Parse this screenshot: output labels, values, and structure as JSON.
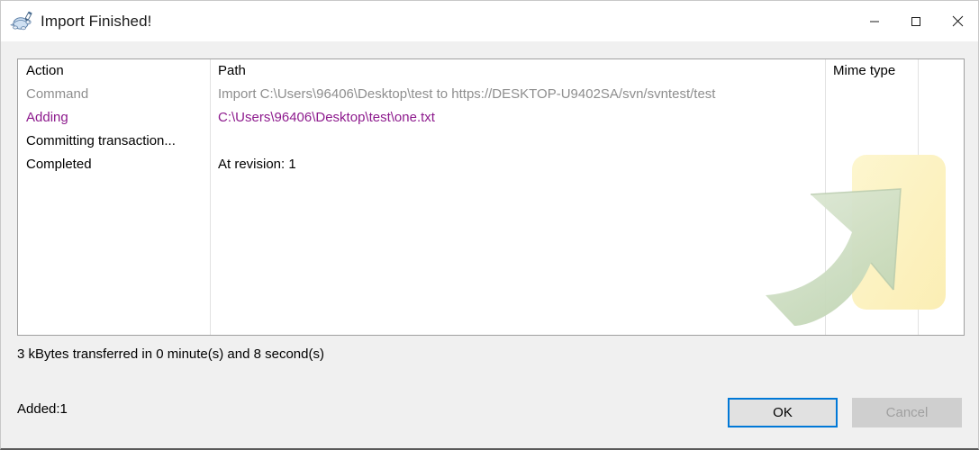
{
  "window": {
    "title": "Import Finished!",
    "icon": "tortoisesvn-turtle-icon",
    "controls": {
      "minimize": "Minimize",
      "maximize": "Maximize",
      "close": "Close"
    }
  },
  "log_table": {
    "columns": [
      "Action",
      "Path",
      "Mime type",
      ""
    ],
    "rows": [
      {
        "style": "command",
        "action": "Command",
        "path": "Import C:\\Users\\96406\\Desktop\\test to https://DESKTOP-U9402SA/svn/svntest/test",
        "mime": ""
      },
      {
        "style": "adding",
        "action": "Adding",
        "path": "C:\\Users\\96406\\Desktop\\test\\one.txt",
        "mime": ""
      },
      {
        "style": "plain",
        "action": "Committing transaction...",
        "path": "",
        "mime": ""
      },
      {
        "style": "done",
        "action": "Completed",
        "path": "At revision: 1",
        "mime": ""
      }
    ]
  },
  "status": {
    "transfer": "3 kBytes transferred in 0 minute(s) and 8 second(s)",
    "added": "Added:1"
  },
  "buttons": {
    "ok": "OK",
    "cancel": "Cancel"
  },
  "colors": {
    "accent": "#0078d7",
    "adding_text": "#8d1a8d",
    "command_text": "#8e8e8e",
    "dialog_bg": "#f0f0f0",
    "list_bg": "#ffffff",
    "watermark_green": "#c6d9bd",
    "watermark_yellow": "#fdf2c0"
  }
}
